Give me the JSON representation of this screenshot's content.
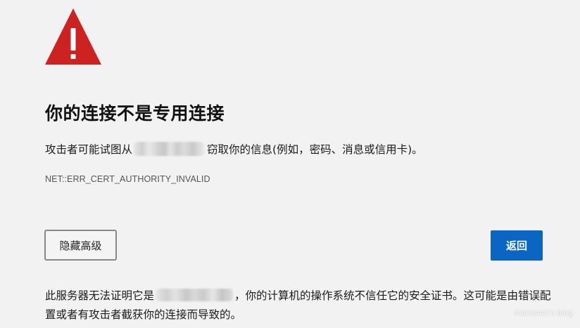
{
  "warning": {
    "icon": "warning-triangle-icon",
    "color": "#cc2222"
  },
  "title": "你的连接不是专用连接",
  "description": {
    "before_host": "攻击者可能试图从",
    "after_host": "窃取你的信息(例如，密码、消息或信用卡)。"
  },
  "error_code": "NET::ERR_CERT_AUTHORITY_INVALID",
  "buttons": {
    "advanced_label": "隐藏高级",
    "back_label": "返回",
    "back_color": "#0b66c3"
  },
  "detail": {
    "before_host": "此服务器无法证明它是",
    "after_host": "，你的计算机的操作系统不信任它的安全证书。这可能是由错误配置或者有攻击者截获你的连接而导致的。"
  },
  "watermark": "marcsam's blog"
}
